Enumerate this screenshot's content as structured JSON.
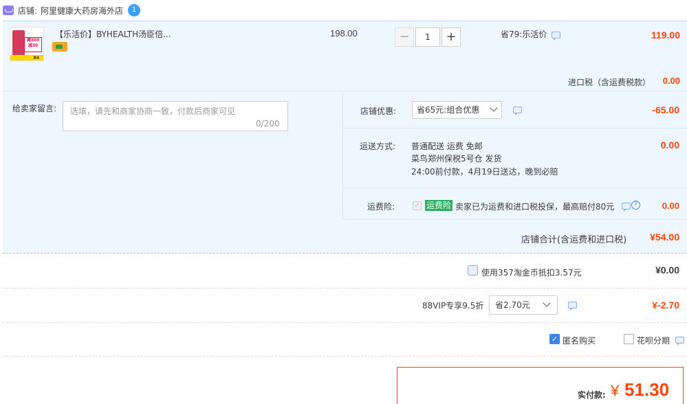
{
  "shop": {
    "label": "店铺:",
    "name": "阿里健康大药房海外店",
    "wang_text": "1"
  },
  "item": {
    "thumb_lines": [
      "满300",
      "减30"
    ],
    "thumb_badge": "84",
    "title": "【乐活价】BYHEALTH汤臣倍...",
    "price": "198.00",
    "quantity": "1",
    "minus": "−",
    "plus": "+",
    "promo": "省79:乐活价",
    "subtotal": "119.00",
    "tax_label": "进口税（含运费税款）",
    "tax_value": "0.00"
  },
  "message": {
    "label": "给卖家留言:",
    "placeholder": "选填，请先和商家协商一致，付款后商家可见",
    "count": "0/200"
  },
  "discount": {
    "label": "店铺优惠:",
    "selected": "省65元:组合优惠",
    "value": "-65.00"
  },
  "shipping": {
    "label": "运送方式:",
    "line1": "普通配送 运费 免邮",
    "line2": "菜鸟郑州保税5号仓   发货",
    "line3": "24:00前付款，4月19日送达，晚到必赔",
    "value": "0.00"
  },
  "insurance": {
    "label": "运费险:",
    "check": "✓",
    "badge": "运费险",
    "text": "卖家已为运费和进口税投保，最高赔付80元",
    "help": "?",
    "value": "0.00"
  },
  "shop_total": {
    "label": "店铺合计(含运费和进口税)",
    "value": "¥54.00"
  },
  "coin": {
    "label": "使用357淘金币抵扣3.57元",
    "value": "¥0.00"
  },
  "vip": {
    "label": "88VIP专享9.5折",
    "selected": "省2.70元",
    "value": "¥-2.70"
  },
  "options": {
    "anon_check": "✓",
    "anon_label": "匿名购买",
    "huabei_label": "花呗分期"
  },
  "payment": {
    "label": "实付款:",
    "yen": "¥",
    "value": "51.30"
  },
  "colors": {
    "accent": "#ff4400",
    "panel_bg": "#eef6ff",
    "badge_green": "#2aae60",
    "checkbox_blue": "#3d84e6"
  }
}
